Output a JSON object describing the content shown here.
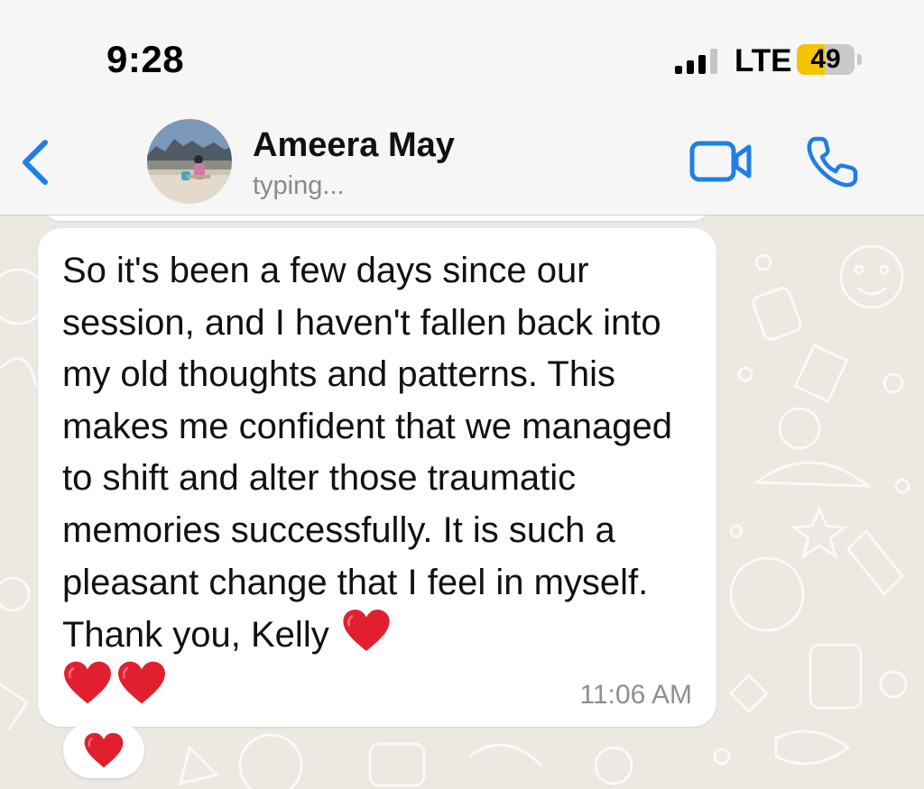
{
  "status_bar": {
    "time": "9:28",
    "network": "LTE",
    "battery_level": "49",
    "battery_fraction": 0.49,
    "signal_bars": 3
  },
  "header": {
    "contact_name": "Ameera May",
    "status": "typing..."
  },
  "message": {
    "text": "So it's been a few days since our session, and I haven't fallen back into my old thoughts and patterns. This makes me confident that we managed to shift and alter those traumatic memories successfully. It is such a pleasant change that I feel in myself. Thank you, Kelly",
    "time": "11:06 AM",
    "trailing_heart_count": 3
  },
  "reaction": {
    "emoji": "heart"
  },
  "colors": {
    "accent": "#1f7fe5",
    "heart": "#e0202e",
    "battery": "#f5c400",
    "chat_background": "#ece8e2"
  }
}
